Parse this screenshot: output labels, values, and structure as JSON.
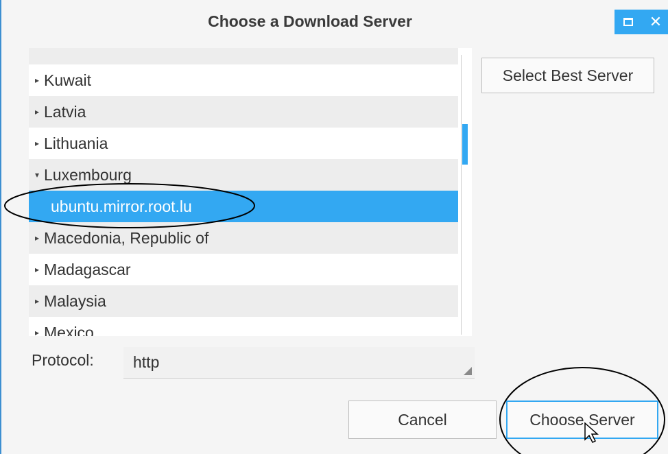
{
  "window": {
    "title": "Choose a Download Server",
    "close_glyph": "✕"
  },
  "tree": {
    "partial_top": "",
    "items": [
      {
        "label": "Kuwait",
        "expanded": false
      },
      {
        "label": "Latvia",
        "expanded": false
      },
      {
        "label": "Lithuania",
        "expanded": false
      },
      {
        "label": "Luxembourg",
        "expanded": true
      },
      {
        "label": "ubuntu.mirror.root.lu",
        "selected": true,
        "child": true
      },
      {
        "label": "Macedonia, Republic of",
        "expanded": false
      },
      {
        "label": "Madagascar",
        "expanded": false
      },
      {
        "label": "Malaysia",
        "expanded": false
      },
      {
        "label": "Mexico",
        "expanded": false
      }
    ]
  },
  "buttons": {
    "select_best": "Select Best Server",
    "cancel": "Cancel",
    "choose": "Choose Server"
  },
  "protocol": {
    "label": "Protocol:",
    "value": "http"
  },
  "icons": {
    "collapsed": "▸",
    "expanded": "▾",
    "maximize": "maximize-icon",
    "close": "close-icon"
  },
  "colors": {
    "accent": "#33a8f2",
    "selection_text": "#ffffff",
    "alt_row": "#ededed",
    "annotation_ellipse": "#000000"
  }
}
